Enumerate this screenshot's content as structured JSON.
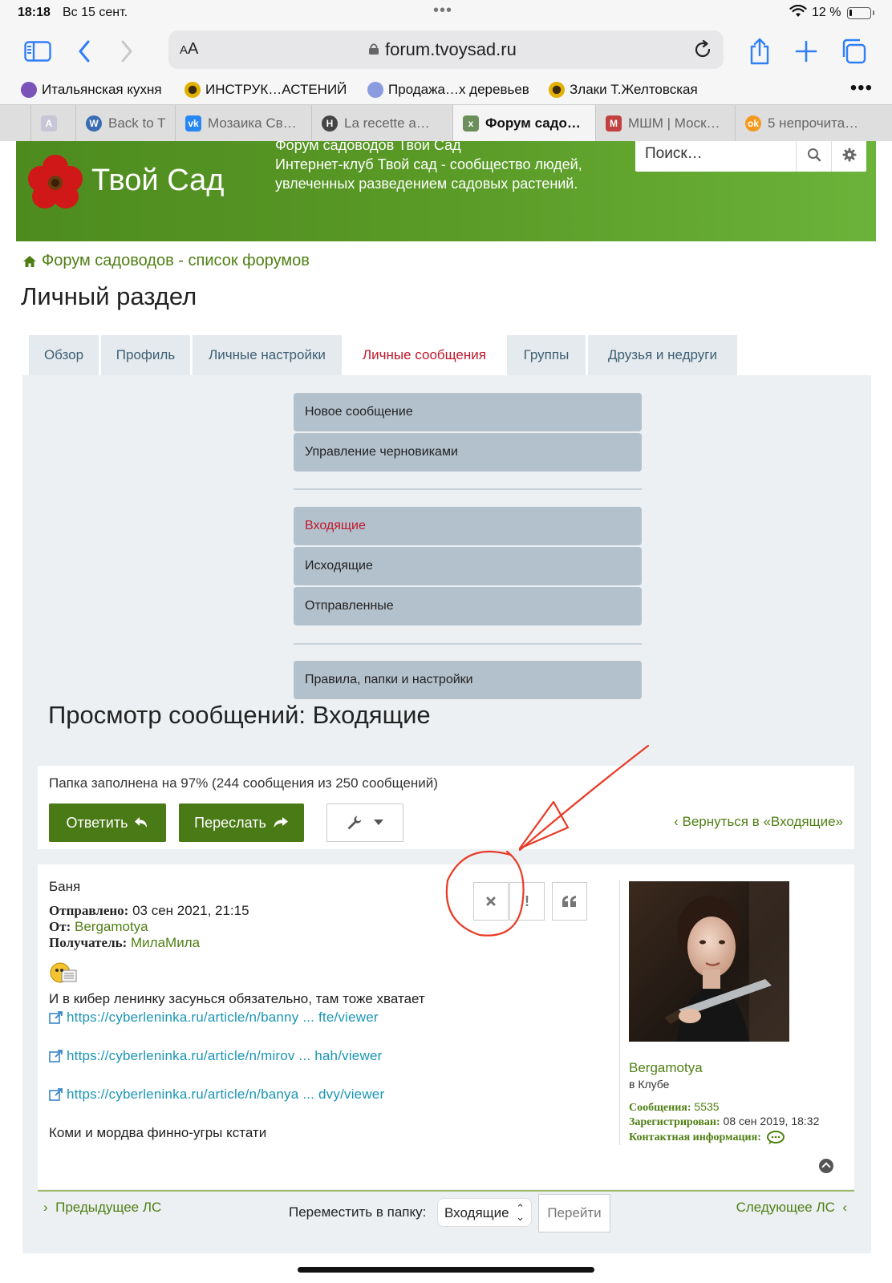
{
  "status": {
    "time": "18:18",
    "date": "Вс 15 сент.",
    "battery": "12 %",
    "battery_level": 0.12
  },
  "browser": {
    "aa": "AA",
    "url": "forum.tvoysad.ru",
    "bookmarks": [
      {
        "label": "Итальянская кухня",
        "color": "#7b52b9"
      },
      {
        "label": "ИНСТРУК…АСТЕНИЙ",
        "color": "#e2b000"
      },
      {
        "label": "Продажа…х деревьев",
        "color": "#8b9be0"
      },
      {
        "label": "Злаки Т.Желтовская",
        "color": "#e2b000"
      }
    ],
    "bookmarks_more": "•••",
    "tabs": [
      {
        "label": "",
        "fav_text": "A",
        "color": "#c6c6d6"
      },
      {
        "label": "Back to T",
        "fav_text": "W",
        "color": "#3a6bb5"
      },
      {
        "label": "Мозаика Св…",
        "fav_text": "vk",
        "color": "#2787f5"
      },
      {
        "label": "La recette a…",
        "fav_text": "H",
        "color": "#444444"
      },
      {
        "label": "Форум садо…",
        "fav_text": "x",
        "color": "#6a8f5a"
      },
      {
        "label": "МШМ | Моск…",
        "fav_text": "М",
        "color": "#c24040"
      },
      {
        "label": "5 непрочита…",
        "fav_text": "ok",
        "color": "#f39a1e"
      }
    ]
  },
  "site": {
    "logo_text": "Твой Сад",
    "description_title": "Форум садоводов Твой Сад",
    "description": "Интернет-клуб Твой сад - сообщество людей, увлеченных разведением садовых растений.",
    "search_placeholder": "Поиск…"
  },
  "breadcrumb": "Форум садоводов - список форумов",
  "page_title": "Личный раздел",
  "nav_tabs": [
    "Обзор",
    "Профиль",
    "Личные настройки",
    "Личные сообщения",
    "Группы",
    "Друзья и недруги"
  ],
  "nav_active": "Личные сообщения",
  "pm_menu": {
    "compose": [
      "Новое сообщение",
      "Управление черновиками"
    ],
    "folders": [
      "Входящие",
      "Исходящие",
      "Отправленные"
    ],
    "settings": [
      "Правила, папки и настройки"
    ]
  },
  "view_title": "Просмотр сообщений: Входящие",
  "folder_info": "Папка заполнена на 97% (244 сообщения из 250 сообщений)",
  "buttons": {
    "reply": "Ответить",
    "forward": "Переслать",
    "back_to_inbox": "Вернуться в «Входящие»"
  },
  "message": {
    "subject": "Баня",
    "sent_label": "Отправлено:",
    "sent_value": "03 сен 2021, 21:15",
    "from_label": "От:",
    "from_value": "Bergamotya",
    "to_label": "Получатель:",
    "to_value": "МилаМила",
    "text1": "И в кибер ленинку засунься обязательно, там тоже хватает",
    "links": [
      "https://cyberleninka.ru/article/n/banny ... fte/viewer",
      "https://cyberleninka.ru/article/n/mirov ... hah/viewer",
      "https://cyberleninka.ru/article/n/banya ... dvy/viewer"
    ],
    "text2": "Коми и мордва финно-угры кстати"
  },
  "profile": {
    "name": "Bergamotya",
    "rank": "в Клубе",
    "posts_label": "Сообщения:",
    "posts_value": "5535",
    "registered_label": "Зарегистрирован:",
    "registered_value": "08 сен 2019, 18:32",
    "contact_label": "Контактная информация:"
  },
  "footer_nav": {
    "prev": "Предыдущее ЛС",
    "next": "Следующее ЛС",
    "move_label": "Переместить в папку:",
    "move_value": "Входящие",
    "go": "Перейти"
  },
  "colors": {
    "accent_green": "#4a7a16",
    "link_green": "#4f7f14",
    "active_red": "#c0172b",
    "annotation_red": "#e83a24"
  }
}
